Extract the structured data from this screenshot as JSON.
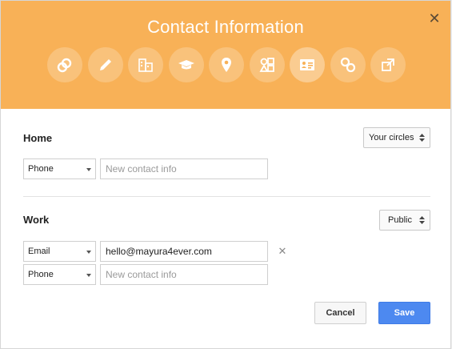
{
  "dialog": {
    "title": "Contact Information",
    "close_glyph": "✕",
    "header_color": "#f8b157",
    "icons": [
      {
        "name": "links-circles-icon",
        "active": false
      },
      {
        "name": "pencil-icon",
        "active": false
      },
      {
        "name": "building-icon",
        "active": false
      },
      {
        "name": "graduation-cap-icon",
        "active": false
      },
      {
        "name": "location-pin-icon",
        "active": false
      },
      {
        "name": "shapes-icon",
        "active": false
      },
      {
        "name": "contact-card-icon",
        "active": true
      },
      {
        "name": "chain-link-icon",
        "active": false
      },
      {
        "name": "external-link-icon",
        "active": false
      }
    ]
  },
  "home": {
    "label": "Home",
    "visibility": "Your circles",
    "rows": [
      {
        "type": "Phone",
        "value": "",
        "placeholder": "New contact info"
      }
    ]
  },
  "work": {
    "label": "Work",
    "visibility": "Public",
    "rows": [
      {
        "type": "Email",
        "value": "hello@mayura4ever.com",
        "placeholder": ""
      },
      {
        "type": "Phone",
        "value": "",
        "placeholder": "New contact info"
      }
    ],
    "remove_glyph": "✕"
  },
  "actions": {
    "cancel_label": "Cancel",
    "save_label": "Save"
  },
  "colors": {
    "accent": "#4d89f0",
    "header": "#f8b157"
  }
}
